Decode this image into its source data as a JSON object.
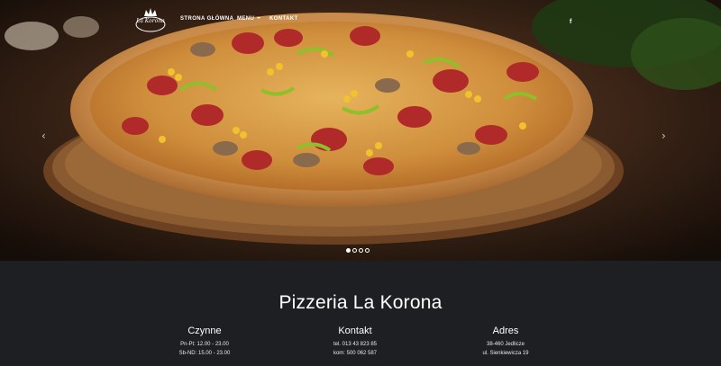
{
  "nav": {
    "logo_text": "La Korona",
    "items": [
      {
        "label": "STRONA GŁÓWNA"
      },
      {
        "label": "MENU"
      },
      {
        "label": "KONTAKT"
      }
    ],
    "social_icon": "facebook-icon",
    "social_glyph": "f"
  },
  "carousel": {
    "prev_glyph": "‹",
    "next_glyph": "›",
    "slides_count": 4,
    "active_slide": 1
  },
  "info": {
    "title": "Pizzeria La Korona",
    "columns": [
      {
        "heading": "Czynne",
        "lines": [
          "Pn-Pt: 12.00 - 23.00",
          "Sb-ND: 15.00 - 23.00"
        ]
      },
      {
        "heading": "Kontakt",
        "lines": [
          "tel. 013 43 823 85",
          "kom: 500 062 587"
        ]
      },
      {
        "heading": "Adres",
        "lines": [
          "38-460 Jedlicze",
          "ul. Sienkiewicza 19"
        ]
      }
    ]
  },
  "colors": {
    "footer_bg": "#1d1f22",
    "text": "#ffffff"
  }
}
